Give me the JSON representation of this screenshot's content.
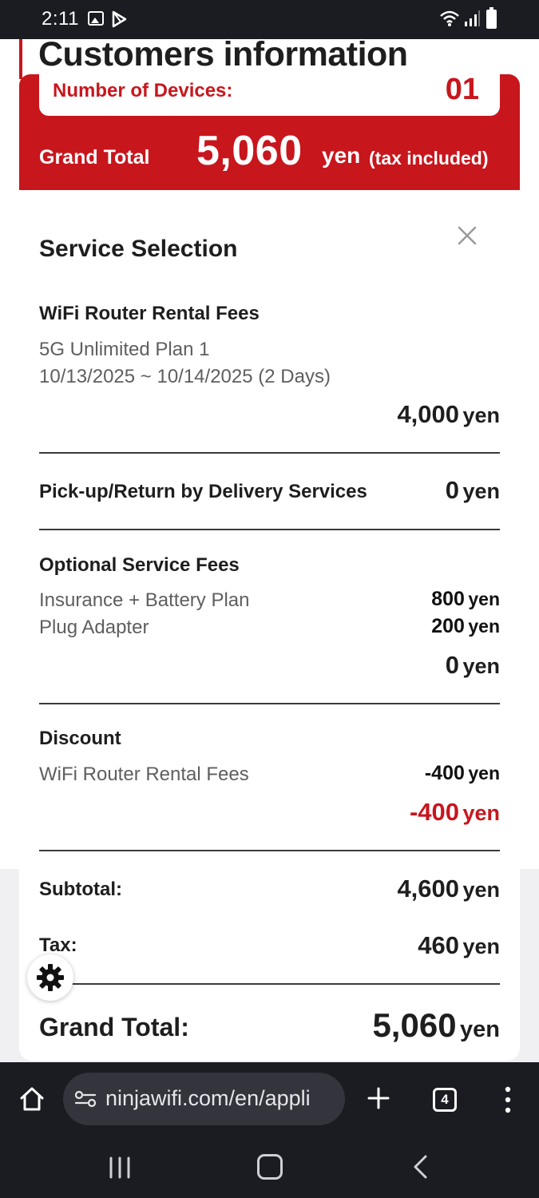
{
  "status_bar": {
    "time": "2:11",
    "icons": [
      "gallery-icon",
      "play-store-icon",
      "wifi-icon",
      "signal-icon",
      "battery-icon"
    ]
  },
  "page": {
    "title": "Customers information"
  },
  "summary": {
    "devices_label": "Number of Devices:",
    "devices_value": "01",
    "grand_total_label": "Grand Total",
    "grand_total_amount": "5,060",
    "grand_total_unit": "yen",
    "grand_total_note": "(tax included)"
  },
  "service_selection": {
    "title": "Service Selection",
    "rental": {
      "heading": "WiFi Router Rental Fees",
      "plan": "5G Unlimited Plan 1",
      "dates": "10/13/2025 ~ 10/14/2025 (2 Days)",
      "amount": "4,000",
      "unit": "yen"
    },
    "delivery": {
      "heading": "Pick-up/Return by Delivery Services",
      "amount": "0",
      "unit": "yen"
    },
    "optional": {
      "heading": "Optional Service Fees",
      "items": [
        {
          "label": "Insurance + Battery Plan",
          "amount": "800",
          "unit": "yen"
        },
        {
          "label": "Plug Adapter",
          "amount": "200",
          "unit": "yen"
        }
      ],
      "total_amount": "0",
      "total_unit": "yen"
    },
    "discount": {
      "heading": "Discount",
      "items": [
        {
          "label": "WiFi Router Rental Fees",
          "amount": "-400",
          "unit": "yen"
        }
      ],
      "total_amount": "-400",
      "total_unit": "yen"
    },
    "subtotal": {
      "label": "Subtotal",
      "colon": ":",
      "amount": "4,600",
      "unit": "yen"
    },
    "tax": {
      "label": "Tax",
      "colon": ":",
      "amount": "460",
      "unit": "yen"
    },
    "grand_total": {
      "label": "Grand Total",
      "colon": ":",
      "amount": "5,060",
      "unit": "yen"
    }
  },
  "browser": {
    "url": "ninjawifi.com/en/appli",
    "tab_count": "4"
  },
  "colors": {
    "brand_red": "#c8161d",
    "dark_bar": "#1b1c22",
    "text_dark": "#1e1e1e",
    "text_muted": "#5e5e5e"
  }
}
